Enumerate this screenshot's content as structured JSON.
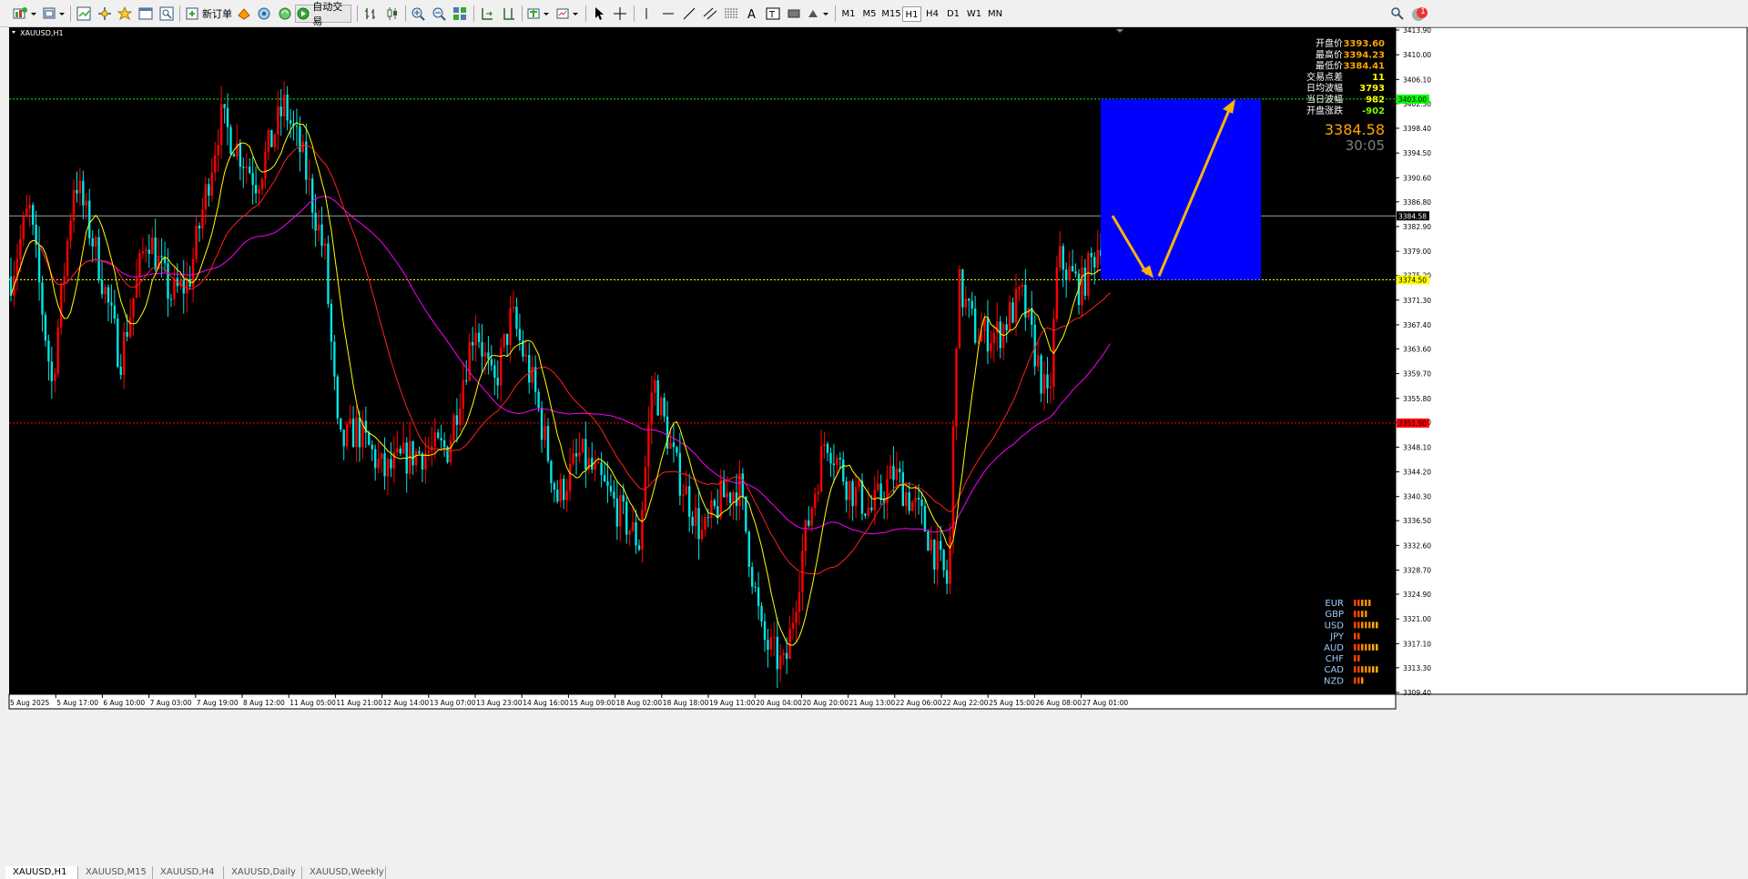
{
  "toolbar": {
    "new_order_label": "新订单",
    "auto_trading_label": "自动交易",
    "timeframes": [
      "M1",
      "M5",
      "M15",
      "H1",
      "H4",
      "D1",
      "W1",
      "MN"
    ],
    "active_timeframe": "H1",
    "icons": [
      "new-chart-icon",
      "profiles-icon",
      "market-watch-icon",
      "navigator-icon",
      "data-window-icon",
      "terminal-icon",
      "tester-icon",
      "new-order-icon",
      "metaeditor-icon",
      "signals-icon",
      "auto-trading-icon",
      "bar-chart-icon",
      "candlestick-icon",
      "line-chart-icon",
      "zoom-in-icon",
      "zoom-out-icon",
      "tile-windows-icon",
      "autoscroll-icon",
      "chart-shift-icon",
      "indicators-icon",
      "periods-icon",
      "templates-icon",
      "cursor-icon",
      "crosshair-icon",
      "vertical-line-icon",
      "horizontal-line-icon",
      "trendline-icon",
      "equidistant-channel-icon",
      "fibonacci-icon",
      "text-icon",
      "text-label-icon",
      "rectangle-icon",
      "arrows-icon",
      "search-icon",
      "notifications-icon"
    ],
    "notification_count": "1"
  },
  "chart": {
    "title": "XAUUSD,H1",
    "symbol": "XAUUSD",
    "timeframe": "H1",
    "background": "#000000",
    "candle_bull_color": "#ff0000",
    "candle_bear_color": "#00e5e5",
    "price_ticks": [
      "3413.90",
      "3410.00",
      "3406.10",
      "3402.30",
      "3398.40",
      "3394.50",
      "3390.60",
      "3386.80",
      "3382.90",
      "3379.00",
      "3375.20",
      "3371.30",
      "3367.40",
      "3363.60",
      "3359.70",
      "3355.80",
      "3352.00",
      "3348.10",
      "3344.20",
      "3340.30",
      "3336.50",
      "3332.60",
      "3328.70",
      "3324.90",
      "3321.00",
      "3317.10",
      "3313.30",
      "3309.40"
    ],
    "time_ticks": [
      "5 Aug 2025",
      "5 Aug 17:00",
      "6 Aug 10:00",
      "7 Aug 03:00",
      "7 Aug 19:00",
      "8 Aug 12:00",
      "11 Aug 05:00",
      "11 Aug 21:00",
      "12 Aug 14:00",
      "13 Aug 07:00",
      "13 Aug 23:00",
      "14 Aug 16:00",
      "15 Aug 09:00",
      "18 Aug 02:00",
      "18 Aug 18:00",
      "19 Aug 11:00",
      "20 Aug 04:00",
      "20 Aug 20:00",
      "21 Aug 13:00",
      "22 Aug 06:00",
      "22 Aug 22:00",
      "25 Aug 15:00",
      "26 Aug 08:00",
      "27 Aug 01:00"
    ],
    "price_range": [
      3309.4,
      3413.9
    ],
    "horizontal_lines": [
      {
        "price": 3403.0,
        "label": "3403.00",
        "color": "#00ff00",
        "style": "dotted"
      },
      {
        "price": 3384.58,
        "label": "3384.58",
        "color": "#a0a0a0",
        "style": "solid"
      },
      {
        "price": 3374.5,
        "label": "3374.50",
        "color": "#ffff00",
        "style": "dotted"
      },
      {
        "price": 3351.9,
        "label": "3351.90",
        "color": "#ff0000",
        "style": "dotted"
      }
    ],
    "info_panel": [
      {
        "label": "开盘价",
        "value": "3393.60",
        "color": "#ffa500"
      },
      {
        "label": "最高价",
        "value": "3394.23",
        "color": "#ffa500"
      },
      {
        "label": "最低价",
        "value": "3384.41",
        "color": "#ffa500"
      },
      {
        "label": "交易点差",
        "value": "11",
        "color": "#ffff00"
      },
      {
        "label": "日均波幅",
        "value": "3793",
        "color": "#ffff00"
      },
      {
        "label": "当日波幅",
        "value": "982",
        "color": "#ffff00"
      },
      {
        "label": "开盘涨跌",
        "value": "-902",
        "color": "#7cfc00"
      }
    ],
    "current_price": "3384.58",
    "countdown": "30:05",
    "currency_strength": [
      {
        "name": "EUR",
        "level": 5
      },
      {
        "name": "GBP",
        "level": 4
      },
      {
        "name": "USD",
        "level": 7
      },
      {
        "name": "JPY",
        "level": 2
      },
      {
        "name": "AUD",
        "level": 7
      },
      {
        "name": "CHF",
        "level": 2
      },
      {
        "name": "CAD",
        "level": 7
      },
      {
        "name": "NZD",
        "level": 3
      }
    ]
  },
  "tabs": [
    "XAUUSD,H1",
    "XAUUSD,M15",
    "XAUUSD,H4",
    "XAUUSD,Daily",
    "XAUUSD,Weekly"
  ],
  "active_tab": 0
}
